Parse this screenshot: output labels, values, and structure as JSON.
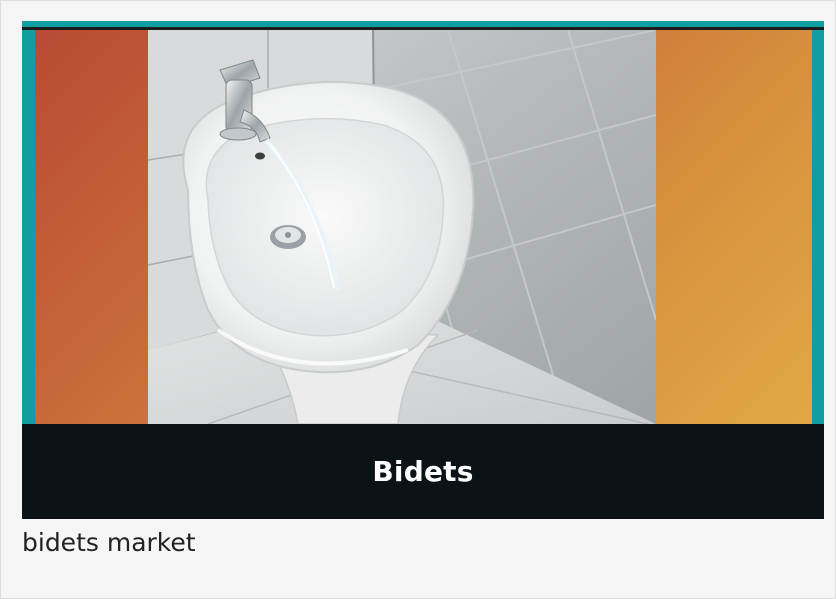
{
  "card": {
    "banner_title": "Bidets",
    "caption": "bidets market"
  },
  "photo": {
    "subject": "bidet-photo"
  },
  "colors": {
    "frame": "#0f9ea2",
    "gradient_start": "#b84a33",
    "gradient_end": "#e0a844",
    "caption_bar": "#0b1316",
    "caption_text": "#ffffff"
  }
}
